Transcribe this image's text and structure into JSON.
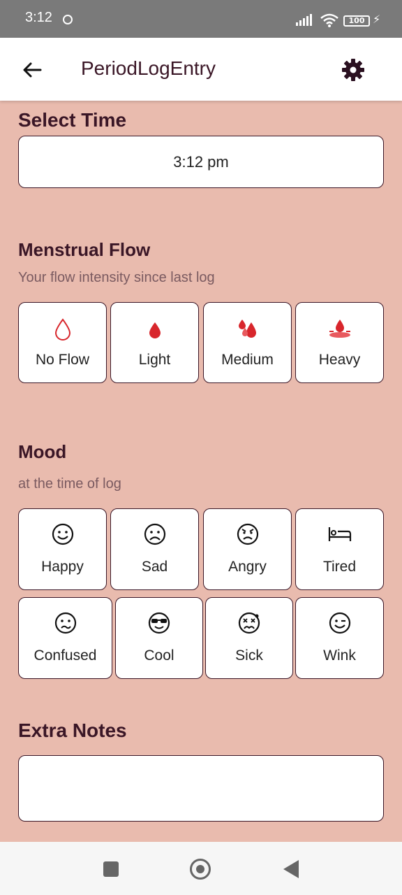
{
  "status_bar": {
    "time": "3:12",
    "battery": "100"
  },
  "app_bar": {
    "title": "PeriodLogEntry"
  },
  "time_section": {
    "title": "Select Time",
    "value": "3:12 pm"
  },
  "flow_section": {
    "title": "Menstrual Flow",
    "subtitle": "Your flow intensity since last log",
    "options": [
      {
        "label": "No Flow",
        "icon": "drop-outline-icon"
      },
      {
        "label": "Light",
        "icon": "drop-filled-icon"
      },
      {
        "label": "Medium",
        "icon": "drops-icon"
      },
      {
        "label": "Heavy",
        "icon": "drop-splash-icon"
      }
    ]
  },
  "mood_section": {
    "title": "Mood",
    "subtitle": "at the time of log",
    "options": [
      {
        "label": "Happy",
        "icon": "happy-face-icon"
      },
      {
        "label": "Sad",
        "icon": "sad-face-icon"
      },
      {
        "label": "Angry",
        "icon": "angry-face-icon"
      },
      {
        "label": "Tired",
        "icon": "bed-icon"
      },
      {
        "label": "Confused",
        "icon": "confused-face-icon"
      },
      {
        "label": "Cool",
        "icon": "sunglasses-face-icon"
      },
      {
        "label": "Sick",
        "icon": "sick-face-icon"
      },
      {
        "label": "Wink",
        "icon": "wink-face-icon"
      }
    ]
  },
  "notes_section": {
    "title": "Extra Notes",
    "value": ""
  },
  "colors": {
    "background": "#e9bbae",
    "accent": "#3a1626",
    "drop_red": "#d8262c"
  }
}
